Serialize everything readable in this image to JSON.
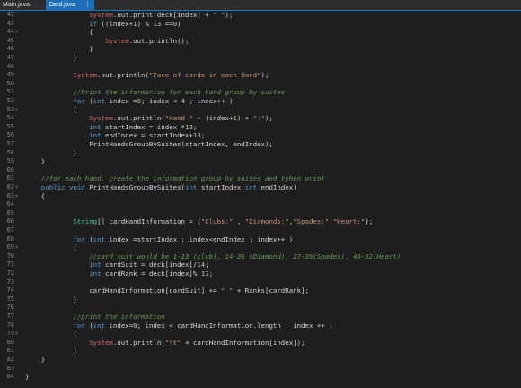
{
  "tabs": [
    {
      "label": "Main.java",
      "active": false
    },
    {
      "label": "Card.java",
      "active": true
    }
  ],
  "tab_menu_icon": "more-vert-icon",
  "code": {
    "lines": [
      {
        "n": "42",
        "fold": false,
        "indent": 16,
        "tokens": [
          [
            "sys",
            "System"
          ],
          [
            "op",
            ".out.print(deck[index] + "
          ],
          [
            "str",
            "\" \""
          ],
          [
            "op",
            ");"
          ]
        ]
      },
      {
        "n": "43",
        "fold": false,
        "indent": 16,
        "tokens": [
          [
            "kw",
            "if"
          ],
          [
            "op",
            " ((index"
          ],
          [
            "num",
            "+1"
          ],
          [
            "op",
            ") % "
          ],
          [
            "num",
            "13"
          ],
          [
            "op",
            " =="
          ],
          [
            "num",
            "0"
          ],
          [
            "op",
            ")"
          ]
        ]
      },
      {
        "n": "44",
        "fold": true,
        "indent": 16,
        "tokens": [
          [
            "op",
            "{"
          ]
        ]
      },
      {
        "n": "45",
        "fold": false,
        "indent": 20,
        "tokens": [
          [
            "sys",
            "System"
          ],
          [
            "op",
            ".out.println();"
          ]
        ]
      },
      {
        "n": "46",
        "fold": false,
        "indent": 16,
        "tokens": [
          [
            "op",
            "}"
          ]
        ]
      },
      {
        "n": "47",
        "fold": false,
        "indent": 12,
        "tokens": [
          [
            "op",
            "}"
          ]
        ]
      },
      {
        "n": "48",
        "fold": false,
        "indent": 0,
        "tokens": []
      },
      {
        "n": "49",
        "fold": false,
        "indent": 12,
        "tokens": [
          [
            "sys",
            "System"
          ],
          [
            "op",
            ".out.println("
          ],
          [
            "str",
            "\"Face of cards in each Hand\""
          ],
          [
            "op",
            ");"
          ]
        ]
      },
      {
        "n": "50",
        "fold": false,
        "indent": 0,
        "tokens": []
      },
      {
        "n": "51",
        "fold": false,
        "indent": 12,
        "tokens": [
          [
            "cm",
            "//Print the informarion for each hand group by suites"
          ]
        ]
      },
      {
        "n": "52",
        "fold": false,
        "indent": 12,
        "tokens": [
          [
            "kw",
            "for"
          ],
          [
            "op",
            " ("
          ],
          [
            "kw",
            "int"
          ],
          [
            "op",
            " index ="
          ],
          [
            "num",
            "0"
          ],
          [
            "op",
            "; index < "
          ],
          [
            "num",
            "4"
          ],
          [
            "op",
            " ; index++ )"
          ]
        ]
      },
      {
        "n": "53",
        "fold": true,
        "indent": 12,
        "tokens": [
          [
            "op",
            "{"
          ]
        ]
      },
      {
        "n": "54",
        "fold": false,
        "indent": 16,
        "tokens": [
          [
            "sys",
            "System"
          ],
          [
            "op",
            ".out.println("
          ],
          [
            "str",
            "\"Hand \""
          ],
          [
            "op",
            " + (index"
          ],
          [
            "num",
            "+1"
          ],
          [
            "op",
            ") + "
          ],
          [
            "str",
            "\":\""
          ],
          [
            "op",
            ");"
          ]
        ]
      },
      {
        "n": "55",
        "fold": false,
        "indent": 16,
        "tokens": [
          [
            "kw",
            "int"
          ],
          [
            "op",
            " startIndex = index *"
          ],
          [
            "num",
            "13"
          ],
          [
            "op",
            ";"
          ]
        ]
      },
      {
        "n": "56",
        "fold": false,
        "indent": 16,
        "tokens": [
          [
            "kw",
            "int"
          ],
          [
            "op",
            " endIndex = startIndex+"
          ],
          [
            "num",
            "13"
          ],
          [
            "op",
            ";"
          ]
        ]
      },
      {
        "n": "57",
        "fold": false,
        "indent": 16,
        "tokens": [
          [
            "op",
            "PrintHandsGroupBySuites(startIndex, endIndex);"
          ]
        ]
      },
      {
        "n": "58",
        "fold": false,
        "indent": 12,
        "tokens": [
          [
            "op",
            "}"
          ]
        ]
      },
      {
        "n": "59",
        "fold": false,
        "indent": 4,
        "tokens": [
          [
            "op",
            "}"
          ]
        ]
      },
      {
        "n": "60",
        "fold": false,
        "indent": 0,
        "tokens": []
      },
      {
        "n": "61",
        "fold": false,
        "indent": 4,
        "tokens": [
          [
            "cm",
            "//for each hand, create the information group by suites and tyhen print"
          ]
        ]
      },
      {
        "n": "62",
        "fold": true,
        "indent": 4,
        "tokens": [
          [
            "kw",
            "public"
          ],
          [
            "op",
            " "
          ],
          [
            "kw",
            "void"
          ],
          [
            "op",
            " PrintHandsGroupBySuites("
          ],
          [
            "kw",
            "int"
          ],
          [
            "op",
            " startIndex,"
          ],
          [
            "kw",
            "int"
          ],
          [
            "op",
            " endIndex)"
          ]
        ]
      },
      {
        "n": "63",
        "fold": true,
        "indent": 4,
        "tokens": [
          [
            "op",
            "{"
          ]
        ]
      },
      {
        "n": "64",
        "fold": false,
        "indent": 0,
        "tokens": []
      },
      {
        "n": "65",
        "fold": false,
        "indent": 0,
        "tokens": []
      },
      {
        "n": "66",
        "fold": false,
        "indent": 12,
        "tokens": [
          [
            "ty",
            "String"
          ],
          [
            "op",
            "[] cardHandInformation = {"
          ],
          [
            "str",
            "\"Clubs:\""
          ],
          [
            "op",
            " , "
          ],
          [
            "str",
            "\"Diamonds:\""
          ],
          [
            "op",
            ","
          ],
          [
            "str",
            "\"Spades:\""
          ],
          [
            "op",
            ","
          ],
          [
            "str",
            "\"Heart:\""
          ],
          [
            "op",
            "};"
          ]
        ]
      },
      {
        "n": "67",
        "fold": false,
        "indent": 0,
        "tokens": []
      },
      {
        "n": "68",
        "fold": false,
        "indent": 12,
        "tokens": [
          [
            "kw",
            "for"
          ],
          [
            "op",
            " ("
          ],
          [
            "kw",
            "int"
          ],
          [
            "op",
            " index =startIndex ; index<endIndex ; index++ )"
          ]
        ]
      },
      {
        "n": "69",
        "fold": true,
        "indent": 12,
        "tokens": [
          [
            "op",
            "{"
          ]
        ]
      },
      {
        "n": "70",
        "fold": false,
        "indent": 16,
        "tokens": [
          [
            "cm",
            "//card suit would be 1-13 (club), 14-26 (Diamond), 27-39(Spades), 40-52(Heart)"
          ]
        ]
      },
      {
        "n": "71",
        "fold": false,
        "indent": 16,
        "tokens": [
          [
            "kw",
            "int"
          ],
          [
            "op",
            " cardSuit = deck[index]/"
          ],
          [
            "num",
            "14"
          ],
          [
            "op",
            ";"
          ]
        ]
      },
      {
        "n": "72",
        "fold": false,
        "indent": 16,
        "tokens": [
          [
            "kw",
            "int"
          ],
          [
            "op",
            " cardRank = deck[index]% "
          ],
          [
            "num",
            "13"
          ],
          [
            "op",
            ";"
          ]
        ]
      },
      {
        "n": "73",
        "fold": false,
        "indent": 0,
        "tokens": []
      },
      {
        "n": "74",
        "fold": false,
        "indent": 16,
        "tokens": [
          [
            "op",
            "cardHandInformation[cardSuit] += "
          ],
          [
            "str",
            "\" \""
          ],
          [
            "op",
            " + Ranks[cardRank];"
          ]
        ]
      },
      {
        "n": "75",
        "fold": false,
        "indent": 12,
        "tokens": [
          [
            "op",
            "}"
          ]
        ]
      },
      {
        "n": "76",
        "fold": false,
        "indent": 0,
        "tokens": []
      },
      {
        "n": "77",
        "fold": false,
        "indent": 12,
        "tokens": [
          [
            "cm",
            "//print the information"
          ]
        ]
      },
      {
        "n": "78",
        "fold": false,
        "indent": 12,
        "tokens": [
          [
            "kw",
            "for"
          ],
          [
            "op",
            " ("
          ],
          [
            "kw",
            "int"
          ],
          [
            "op",
            " index="
          ],
          [
            "num",
            "0"
          ],
          [
            "op",
            "; index < cardHandInformation.length ; index ++ )"
          ]
        ]
      },
      {
        "n": "79",
        "fold": true,
        "indent": 12,
        "tokens": [
          [
            "op",
            "{"
          ]
        ]
      },
      {
        "n": "80",
        "fold": false,
        "indent": 16,
        "tokens": [
          [
            "sys",
            "System"
          ],
          [
            "op",
            ".out.println("
          ],
          [
            "str",
            "\"\\t\""
          ],
          [
            "op",
            " + cardHandInformation[index]);"
          ]
        ]
      },
      {
        "n": "81",
        "fold": false,
        "indent": 12,
        "tokens": [
          [
            "op",
            "}"
          ]
        ]
      },
      {
        "n": "82",
        "fold": false,
        "indent": 4,
        "tokens": [
          [
            "op",
            "}"
          ]
        ]
      },
      {
        "n": "83",
        "fold": false,
        "indent": 0,
        "tokens": []
      },
      {
        "n": "84",
        "fold": false,
        "indent": 0,
        "tokens": [
          [
            "op",
            "}"
          ]
        ]
      }
    ]
  }
}
